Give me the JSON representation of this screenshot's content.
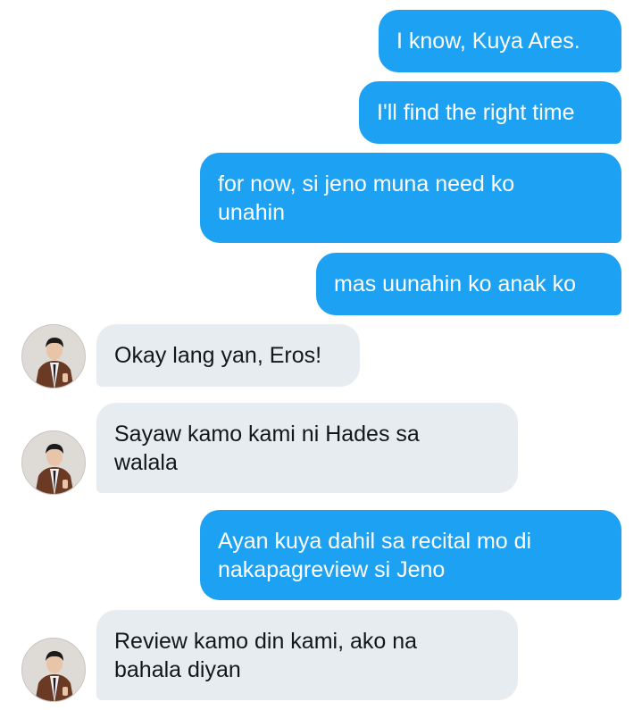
{
  "conversation": {
    "messages": [
      {
        "side": "sent",
        "text": "I know, Kuya Ares."
      },
      {
        "side": "sent",
        "text": "I'll find the right time"
      },
      {
        "side": "sent",
        "text": "for now, si jeno muna need ko\nunahin"
      },
      {
        "side": "sent",
        "text": "mas uunahin ko anak ko"
      },
      {
        "side": "received",
        "text": "Okay lang yan, Eros!"
      },
      {
        "side": "received",
        "text": "Sayaw kamo kami ni Hades sa\nwalala"
      },
      {
        "side": "sent",
        "text": "Ayan kuya dahil sa recital mo di\nnakapagreview si Jeno"
      },
      {
        "side": "received",
        "text": "Review kamo din kami, ako na\nbahala diyan"
      }
    ]
  },
  "colors": {
    "sent_bubble": "#1da1f2",
    "received_bubble": "#e6ecf0",
    "sent_text": "#ffffff",
    "received_text": "#14171a"
  },
  "icons": {
    "avatar": "contact-avatar-photo"
  }
}
